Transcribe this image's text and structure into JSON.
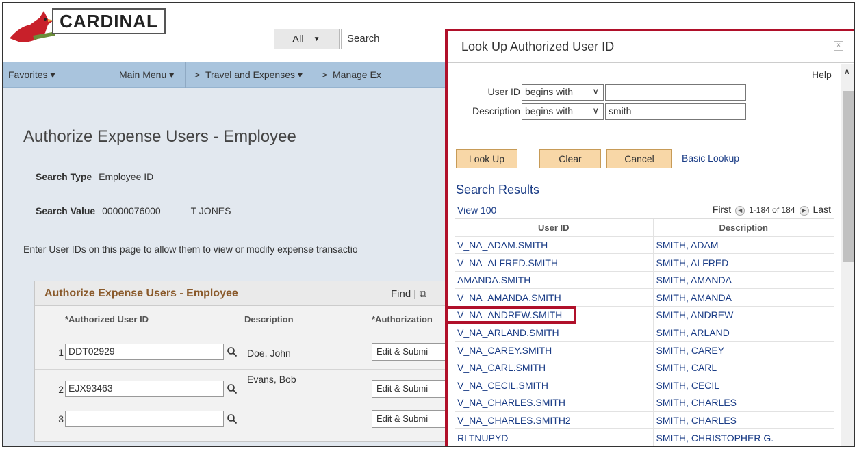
{
  "header": {
    "logo_text": "CARDINAL",
    "scope_label": "All",
    "search_placeholder": "Search"
  },
  "nav": {
    "favorites": "Favorites ▾",
    "main_menu": "Main Menu ▾",
    "sep1": ">",
    "travel": "Travel and Expenses ▾",
    "sep2": ">",
    "manage": "Manage Ex"
  },
  "page": {
    "title": "Authorize Expense Users - Employee",
    "search_type_label": "Search Type",
    "search_type_value": "Employee ID",
    "search_value_label": "Search Value",
    "search_value_value": "00000076000",
    "search_value_name": "T JONES",
    "instructions": "Enter User IDs on this page to allow them to view or modify expense transactio"
  },
  "grid": {
    "title": "Authorize Expense Users - Employee",
    "find": "Find | ⧉",
    "col_user_id": "*Authorized User ID",
    "col_description": "Description",
    "col_authorization": "*Authorization",
    "rows": [
      {
        "num": "1",
        "user_id": "DDT02929",
        "description": "Doe, John",
        "authorization": "Edit & Submi"
      },
      {
        "num": "2",
        "user_id": "EJX93463",
        "description": "Evans, Bob",
        "authorization": "Edit & Submi"
      },
      {
        "num": "3",
        "user_id": "",
        "description": "",
        "authorization": "Edit & Submi"
      }
    ]
  },
  "modal": {
    "title": "Look Up Authorized User ID",
    "close": "×",
    "help": "Help",
    "user_id_label": "User ID",
    "user_id_operator": "begins with",
    "user_id_value": "",
    "description_label": "Description",
    "description_operator": "begins with",
    "description_value": "smith",
    "btn_lookup": "Look Up",
    "btn_clear": "Clear",
    "btn_cancel": "Cancel",
    "basic_lookup": "Basic Lookup",
    "results_title": "Search Results",
    "view_all": "View 100",
    "pager_first": "First",
    "pager_range": "1-184 of 184",
    "pager_last": "Last",
    "col_user_id": "User ID",
    "col_description": "Description",
    "results": [
      {
        "user_id": "V_NA_ADAM.SMITH",
        "description": "SMITH, ADAM"
      },
      {
        "user_id": "V_NA_ALFRED.SMITH",
        "description": "SMITH, ALFRED"
      },
      {
        "user_id": "AMANDA.SMITH",
        "description": "SMITH, AMANDA"
      },
      {
        "user_id": "V_NA_AMANDA.SMITH",
        "description": "SMITH, AMANDA"
      },
      {
        "user_id": "V_NA_ANDREW.SMITH",
        "description": "SMITH, ANDREW"
      },
      {
        "user_id": "V_NA_ARLAND.SMITH",
        "description": "SMITH, ARLAND"
      },
      {
        "user_id": "V_NA_CAREY.SMITH",
        "description": "SMITH, CAREY"
      },
      {
        "user_id": "V_NA_CARL.SMITH",
        "description": "SMITH, CARL"
      },
      {
        "user_id": "V_NA_CECIL.SMITH",
        "description": "SMITH, CECIL"
      },
      {
        "user_id": "V_NA_CHARLES.SMITH",
        "description": "SMITH, CHARLES"
      },
      {
        "user_id": "V_NA_CHARLES.SMITH2",
        "description": "SMITH, CHARLES"
      },
      {
        "user_id": "RLTNUPYD",
        "description": "SMITH, CHRISTOPHER G."
      }
    ]
  },
  "colors": {
    "highlight": "#b0102a",
    "nav_bg": "#a9c4dd",
    "button_bg": "#f8d7a7",
    "link": "#1a3c86"
  }
}
